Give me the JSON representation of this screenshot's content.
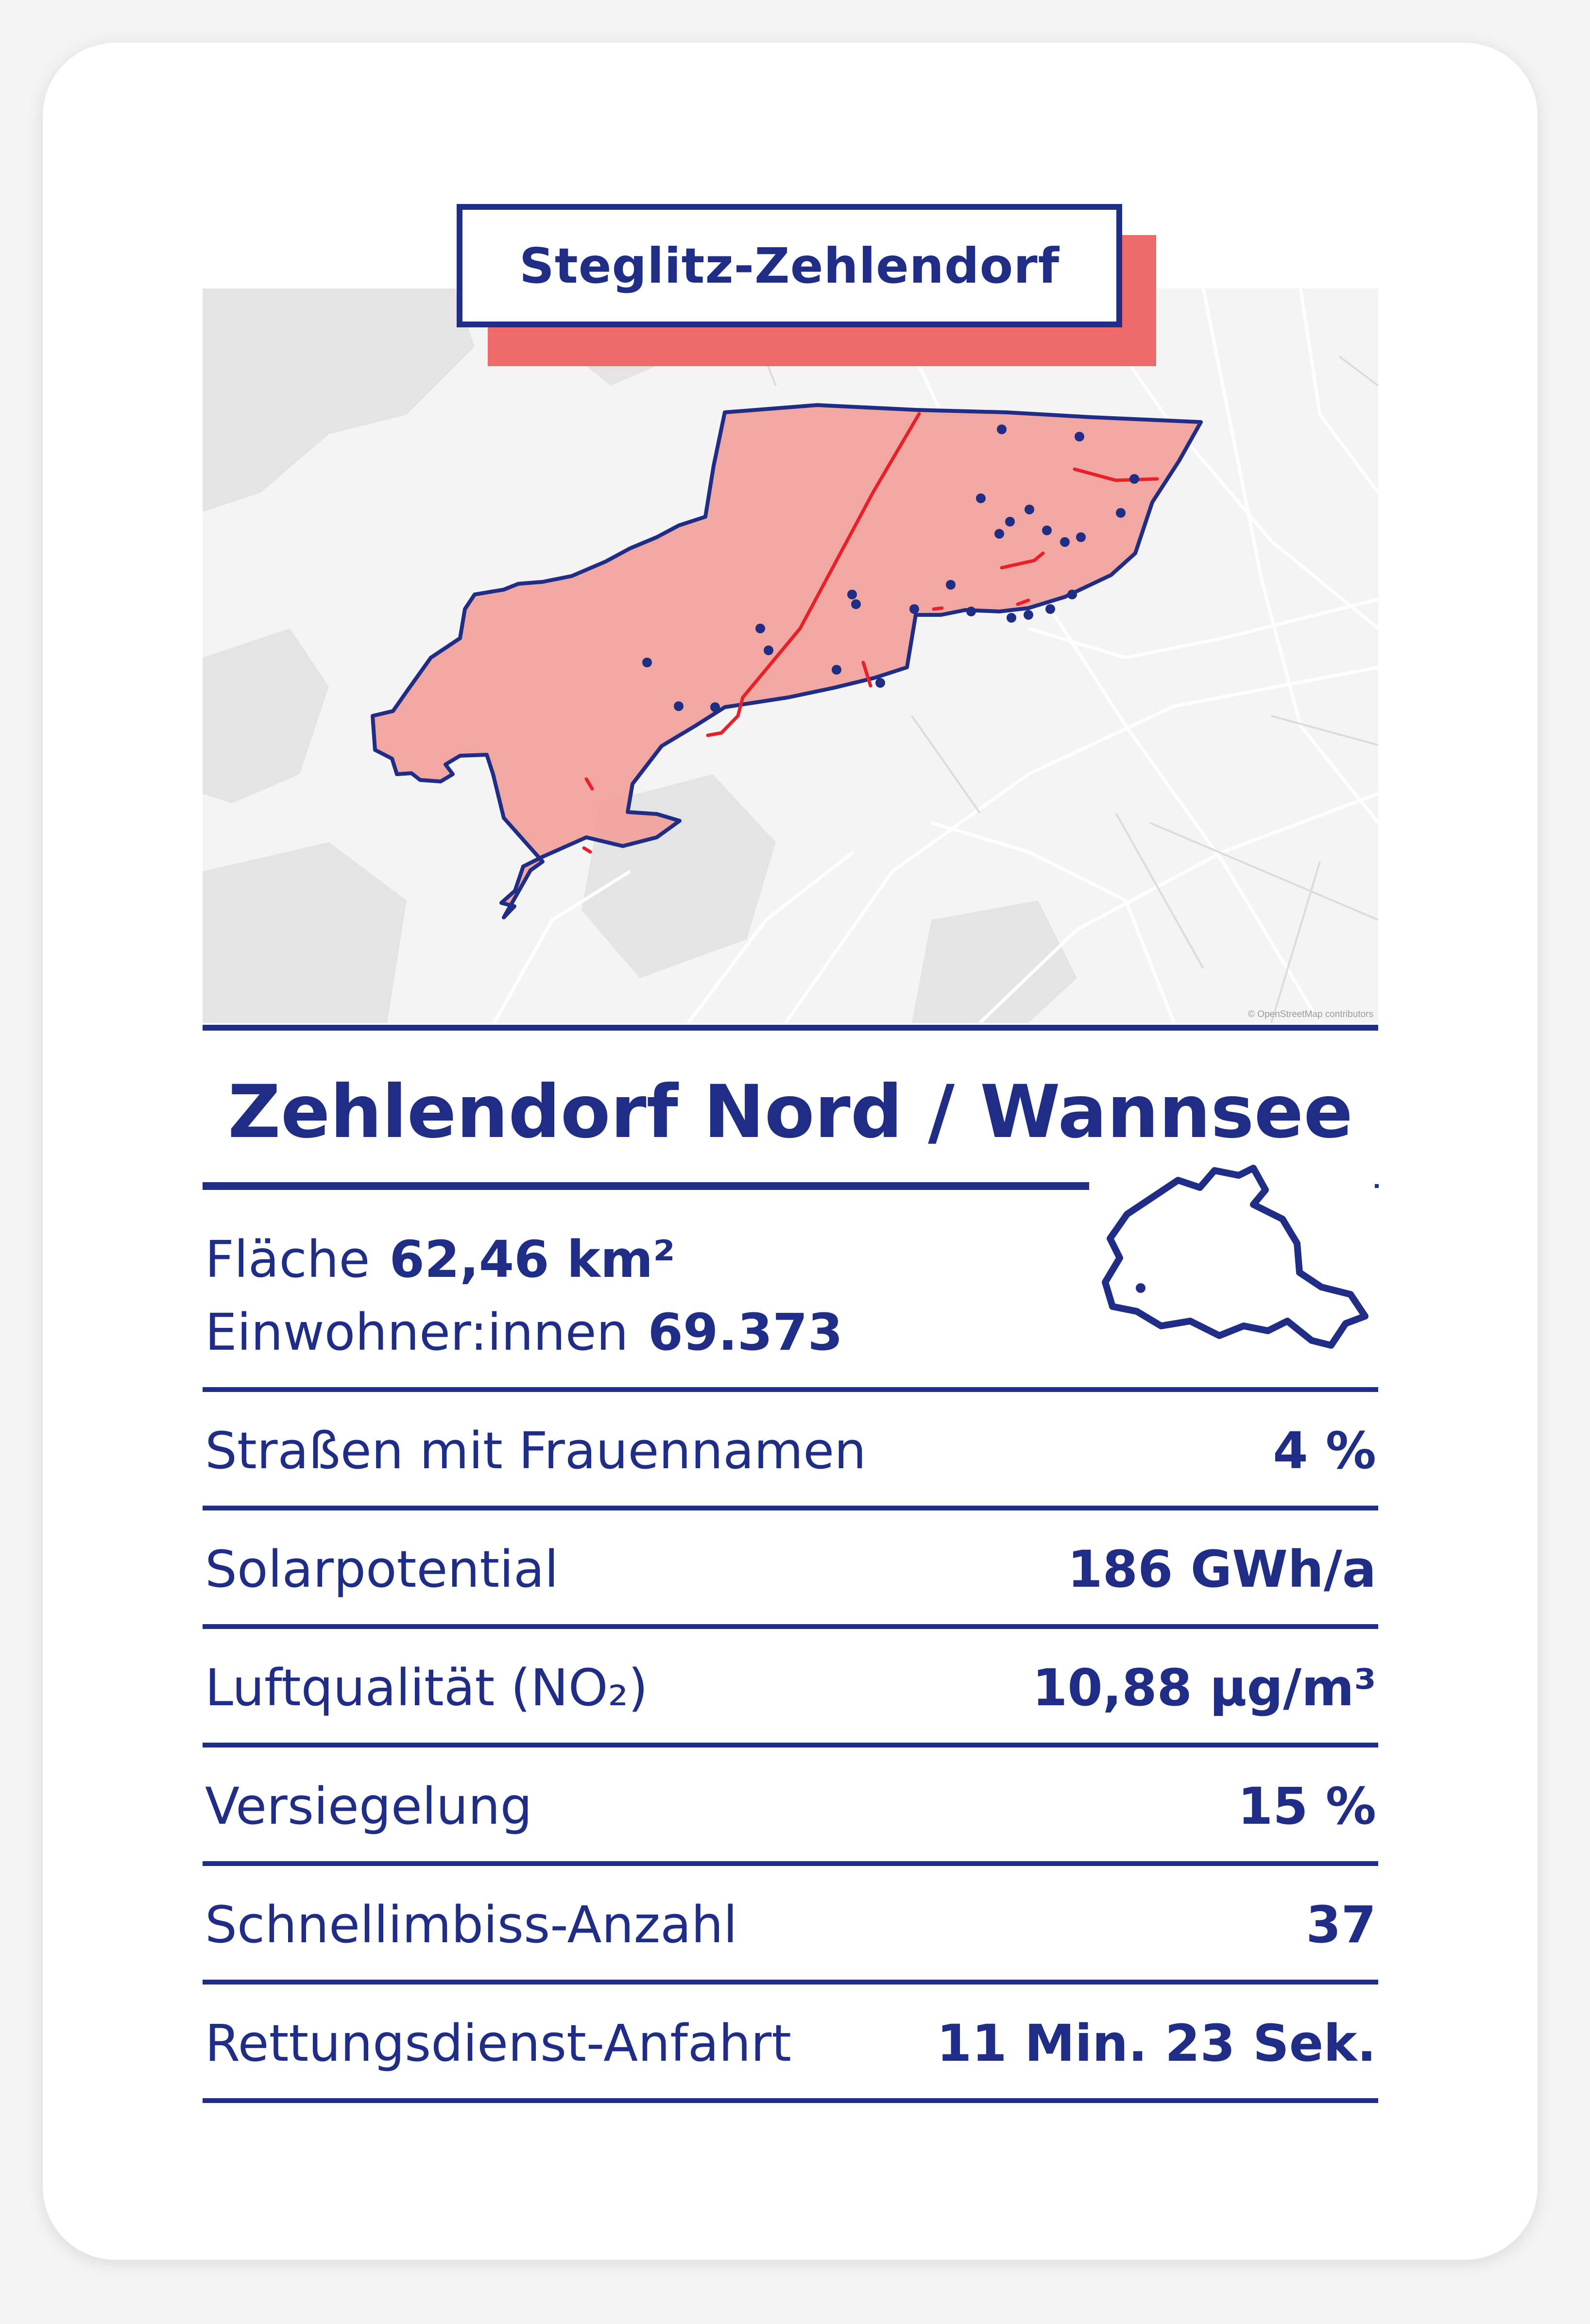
{
  "district": "Steglitz-Zehlendorf",
  "map_credit": "© OpenStreetMap contributors",
  "title": "Zehlendorf Nord / Wannsee",
  "area": {
    "label": "Fläche",
    "value": "62,46 km²"
  },
  "population": {
    "label": "Einwohner:innen",
    "value": "69.373"
  },
  "stats": [
    {
      "label": "Straßen mit Frauennamen",
      "value": "4 %"
    },
    {
      "label": "Solarpotential",
      "value": "186 GWh/a"
    },
    {
      "label": "Luftqualität (NO₂)",
      "value": "10,88 µg/m³"
    },
    {
      "label": "Versiegelung",
      "value": "15 %"
    },
    {
      "label": "Schnellimbiss-Anzahl",
      "value": "37"
    },
    {
      "label": "Rettungsdienst-Anfahrt",
      "value": "11 Min. 23 Sek."
    }
  ],
  "colors": {
    "navy": "#1f2d86",
    "accent_red": "#ee6b6b",
    "area_fill": "#f1a39d",
    "street_red": "#e8202a"
  },
  "icons": {
    "map": "district-area-map",
    "berlin": "berlin-outline-icon"
  }
}
